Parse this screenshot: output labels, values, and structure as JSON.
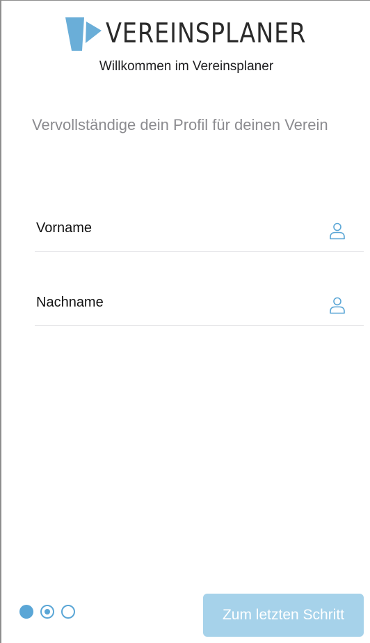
{
  "header": {
    "logo_text": "VEREINSPLANER",
    "subtitle": "Willkommen im Vereinsplaner"
  },
  "intro": "Vervollständige dein Profil für deinen Verein",
  "fields": [
    {
      "label": "Vorname",
      "icon": "user-icon"
    },
    {
      "label": "Nachname",
      "icon": "user-icon"
    }
  ],
  "pager": {
    "total_steps": 3,
    "current_step": 2
  },
  "next_button": {
    "label": "Zum letzten Schritt"
  },
  "colors": {
    "accent": "#5aa6d6",
    "button_disabled": "#a6d2ea",
    "logo_blue": "#6aaed8",
    "text_muted": "#8b8b8f"
  }
}
